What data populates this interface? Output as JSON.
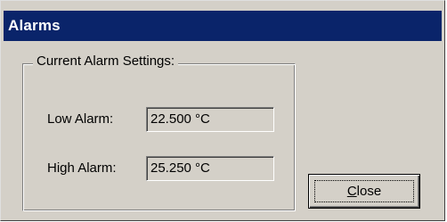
{
  "window": {
    "title": "Alarms"
  },
  "alarm_settings": {
    "group_label": "Current Alarm Settings:",
    "low_label": "Low Alarm:",
    "low_value": "22.500 °C",
    "high_label": "High Alarm:",
    "high_value": "25.250 °C"
  },
  "buttons": {
    "close_mnemonic": "C",
    "close_rest": "lose"
  },
  "colors": {
    "titlebar": "#0a246a",
    "face": "#d4d0c8"
  }
}
